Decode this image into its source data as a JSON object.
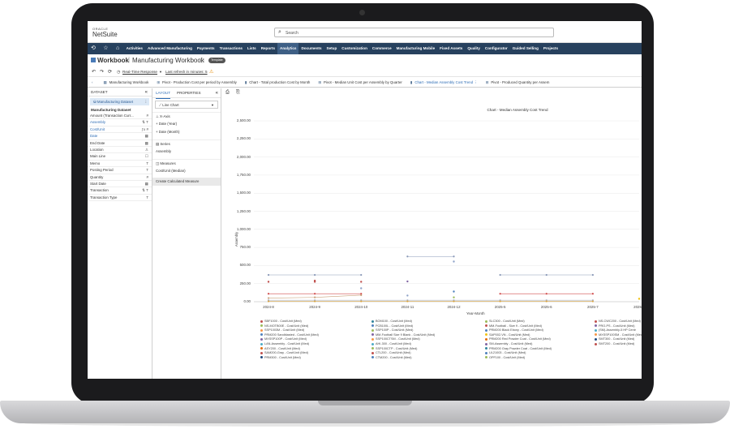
{
  "header": {
    "oracle": "ORACLE",
    "brand": "NetSuite",
    "search_placeholder": "Search"
  },
  "nav": {
    "icons": [
      "history-icon",
      "star-icon",
      "home-icon"
    ],
    "items": [
      "Activities",
      "Advanced Manufacturing",
      "Payments",
      "Transactions",
      "Lists",
      "Reports",
      "Analytics",
      "Documents",
      "Setup",
      "Customization",
      "Commerce",
      "Manufacturing Mobile",
      "Fixed Assets",
      "Quality",
      "Configurator",
      "Guided Selling",
      "Projects"
    ],
    "active_index": 6
  },
  "title": {
    "label": "Workbook",
    "name": "Manufacturing Workbook",
    "badge": "Template"
  },
  "response": {
    "mode": "Real-Time Response",
    "refresh": "Last refresh in minutes: 5"
  },
  "tabs": [
    {
      "icon": "chevron-left-icon",
      "label": ""
    },
    {
      "icon": "table-icon",
      "label": "Manufacturing Workbook"
    },
    {
      "icon": "pivot-icon",
      "label": "Pivot - Production Cost per period by Assembly"
    },
    {
      "icon": "chart-icon",
      "label": "Chart - Total production Cost by Month"
    },
    {
      "icon": "pivot-icon",
      "label": "Pivot - Median Unit Cost per Assembly by Quarter"
    },
    {
      "icon": "chart-icon",
      "label": "Chart - Median Assembly Cost Trend",
      "active": true
    },
    {
      "icon": "pivot-icon",
      "label": "Pivot - Produced Quantity per Assem"
    }
  ],
  "dataset": {
    "header": "DATASET",
    "button": "Manufacturing Dataset",
    "name": "Manufacturing Dataset",
    "fields": [
      {
        "label": "Amount (Transaction Curr...",
        "type": "#",
        "blue": false
      },
      {
        "label": "Assembly",
        "type": "⇅ T",
        "blue": true
      },
      {
        "label": "Cost/Unit",
        "type": "ƒx #",
        "blue": true
      },
      {
        "label": "Date",
        "type": "▦",
        "blue": true
      },
      {
        "label": "End Date",
        "type": "▦",
        "blue": false
      },
      {
        "label": "Location",
        "type": "♙",
        "blue": false
      },
      {
        "label": "Main Line",
        "type": "☐",
        "blue": false
      },
      {
        "label": "Memo",
        "type": "T",
        "blue": false
      },
      {
        "label": "Posting Period",
        "type": "T",
        "blue": false
      },
      {
        "label": "Quantity",
        "type": "#",
        "blue": false
      },
      {
        "label": "Start Date",
        "type": "▦",
        "blue": false
      },
      {
        "label": "Transaction",
        "type": "⇅ T",
        "blue": false
      },
      {
        "label": "Transaction Type",
        "type": "T",
        "blue": false
      }
    ]
  },
  "layout_panel": {
    "tab_layout": "LAYOUT",
    "tab_properties": "PROPERTIES",
    "chart_type": "Line Chart",
    "xaxis_title": "X-Axis",
    "xaxis_items": [
      "Date (Year)",
      "Date (Month)"
    ],
    "series_title": "Series",
    "series_items": [
      "Assembly"
    ],
    "measures_title": "Measures",
    "measures_items": [
      "Cost/Unit (Median)"
    ],
    "calc_button": "Create Calculated Measure"
  },
  "chart_data": {
    "type": "line",
    "title": "Chart - Median Assembly Cost Trend",
    "xlabel": "Year-Month",
    "ylabel": "Assembly",
    "categories": [
      "2024-8",
      "2024-9",
      "2024-10",
      "2024-11",
      "2024-12",
      "2025-5",
      "2025-6",
      "2025-7",
      "2025-8"
    ],
    "yticks": [
      "0.00",
      "250.00",
      "500.00",
      "750.00",
      "1,000.00",
      "1,250.00",
      "1,500.00",
      "1,750.00",
      "2,000.00",
      "2,250.00",
      "2,500.00"
    ],
    "ylim": [
      0,
      2500
    ],
    "grid": true,
    "legend_placement": "bottom",
    "series": [
      {
        "name": "SBF1000 - Cost/Unit (Med)",
        "color": "#c0504d",
        "values": [
          275,
          275,
          275,
          null,
          null,
          null,
          null,
          null,
          null
        ]
      },
      {
        "name": "NS-MOTB00E - Cost/Unit (Med)",
        "color": "#9bbb59",
        "values": [
          null,
          null,
          null,
          null,
          null,
          null,
          null,
          null,
          null
        ]
      },
      {
        "name": "SSP1003M - Cost/Unit (Med)",
        "color": "#f79646",
        "values": [
          null,
          null,
          null,
          null,
          null,
          null,
          null,
          null,
          null
        ]
      },
      {
        "name": "PRM200 Sandblasted - Cost/Unit (Med)",
        "color": "#4f81bd",
        "values": [
          null,
          null,
          null,
          null,
          null,
          null,
          null,
          null,
          null
        ]
      },
      {
        "name": "MXSSP100P - Cost/Unit (Med)",
        "color": "#8064a2",
        "values": [
          null,
          null,
          null,
          null,
          null,
          null,
          null,
          null,
          null
        ]
      },
      {
        "name": "LAN-Assembly - Cost/Unit (Med)",
        "color": "#4bacc6",
        "values": [
          null,
          null,
          null,
          null,
          null,
          null,
          null,
          null,
          null
        ]
      },
      {
        "name": "ASY200 - Cost/Unit (Med)",
        "color": "#e36c09",
        "values": [
          null,
          null,
          null,
          null,
          null,
          null,
          null,
          null,
          null
        ]
      },
      {
        "name": "SAM200-Gray - Cost/Unit (Med)",
        "color": "#c0504d",
        "values": [
          null,
          null,
          null,
          null,
          null,
          null,
          null,
          null,
          null
        ]
      },
      {
        "name": "PRM300 - Cost/Unit (Med)",
        "color": "#1f497d",
        "values": [
          null,
          null,
          null,
          null,
          null,
          null,
          null,
          null,
          null
        ]
      },
      {
        "name": "BOM100 - Cost/Unit (Med)",
        "color": "#31859c",
        "values": [
          null,
          null,
          null,
          null,
          null,
          null,
          null,
          null,
          null
        ]
      },
      {
        "name": "PCB100L - Cost/Unit (Med)",
        "color": "#4f81bd",
        "values": [
          null,
          null,
          null,
          null,
          null,
          null,
          null,
          null,
          null
        ]
      },
      {
        "name": "SSP100P - Cost/Unit (Med)",
        "color": "#9bbb59",
        "values": [
          null,
          null,
          null,
          null,
          null,
          null,
          null,
          null,
          null
        ]
      },
      {
        "name": "MM-Football Size 9 Blank - Cost/Unit (Med)",
        "color": "#8064a2",
        "values": [
          null,
          null,
          null,
          null,
          null,
          null,
          null,
          null,
          null
        ]
      },
      {
        "name": "SSP100CTSM - Cost/Unit (Med)",
        "color": "#f79646",
        "values": [
          null,
          null,
          null,
          null,
          null,
          null,
          null,
          null,
          null
        ]
      },
      {
        "name": "AHI-300 - Cost/Unit (Med)",
        "color": "#4bacc6",
        "values": [
          null,
          null,
          null,
          null,
          null,
          null,
          null,
          null,
          null
        ]
      },
      {
        "name": "SSP100CTP - Cost/Unit (Med)",
        "color": "#9bbb59",
        "values": [
          null,
          null,
          null,
          null,
          null,
          null,
          null,
          null,
          null
        ]
      },
      {
        "name": "CTL200 - Cost/Unit (Med)",
        "color": "#c0504d",
        "values": [
          null,
          null,
          null,
          null,
          null,
          null,
          null,
          null,
          null
        ]
      },
      {
        "name": "CTM200 - Cost/Unit (Med)",
        "color": "#4f81bd",
        "values": [
          null,
          null,
          null,
          null,
          null,
          null,
          null,
          null,
          null
        ]
      },
      {
        "name": "SLC300 - Cost/Unit (Med)",
        "color": "#9bbb59",
        "values": [
          null,
          null,
          null,
          null,
          null,
          null,
          null,
          null,
          null
        ]
      },
      {
        "name": "MM-Football - Size 9 - Cost/Unit (Med)",
        "color": "#c0504d",
        "values": [
          null,
          null,
          null,
          null,
          null,
          null,
          null,
          null,
          null
        ]
      },
      {
        "name": "PRM200 Black Ebony - Cost/Unit (Med)",
        "color": "#4f81bd",
        "values": [
          null,
          null,
          null,
          null,
          null,
          null,
          null,
          null,
          null
        ]
      },
      {
        "name": "SAP002-VN - Cost/Unit (Med)",
        "color": "#f2c314",
        "values": [
          null,
          null,
          null,
          null,
          null,
          null,
          null,
          null,
          40
        ]
      },
      {
        "name": "PRM200 Red Powder Coat - Cost/Unit (Med)",
        "color": "#e36c09",
        "values": [
          null,
          null,
          null,
          null,
          null,
          null,
          null,
          null,
          null
        ]
      },
      {
        "name": "SM-Assembly - Cost/Unit (Med)",
        "color": "#8064a2",
        "values": [
          null,
          null,
          null,
          null,
          null,
          null,
          null,
          null,
          null
        ]
      },
      {
        "name": "PRM200 Gray Powder Coat - Cost/Unit (Med)",
        "color": "#31859c",
        "values": [
          null,
          null,
          null,
          null,
          null,
          null,
          null,
          null,
          null
        ]
      },
      {
        "name": "UL21003 - Cost/Unit (Med)",
        "color": "#4f81bd",
        "values": [
          null,
          null,
          null,
          null,
          null,
          null,
          null,
          null,
          null
        ]
      },
      {
        "name": "OPF100 - Cost/Unit (Med)",
        "color": "#9bbb59",
        "values": [
          null,
          null,
          null,
          null,
          null,
          null,
          null,
          null,
          null
        ]
      },
      {
        "name": "NS-CWC200 - Cost/Unit (Med)",
        "color": "#c0504d",
        "values": [
          null,
          null,
          null,
          null,
          null,
          null,
          null,
          null,
          null
        ]
      },
      {
        "name": "PRO-PS - Cost/Unit (Med)",
        "color": "#8064a2",
        "values": [
          null,
          null,
          null,
          null,
          null,
          null,
          null,
          null,
          null
        ]
      },
      {
        "name": "(SM)-Assembly-5 HP Centr",
        "color": "#4bacc6",
        "values": [
          null,
          null,
          null,
          null,
          null,
          null,
          null,
          null,
          null
        ]
      },
      {
        "name": "MXSSP100SM - Cost/Unit (Med)",
        "color": "#f79646",
        "values": [
          null,
          null,
          null,
          null,
          null,
          null,
          null,
          null,
          null
        ]
      },
      {
        "name": "SMT300 - Cost/Unit (Med)",
        "color": "#1f497d",
        "values": [
          null,
          null,
          null,
          null,
          null,
          null,
          null,
          null,
          null
        ]
      },
      {
        "name": "SMT200 - Cost/Unit (Med)",
        "color": "#c0504d",
        "values": [
          null,
          null,
          null,
          null,
          null,
          null,
          null,
          null,
          null
        ]
      }
    ],
    "lines": [
      {
        "color": "#8a99b8",
        "values": [
          370,
          370,
          370,
          null,
          null,
          370,
          370,
          370,
          null
        ]
      },
      {
        "color": "#8a99b8",
        "values": [
          null,
          null,
          null,
          625,
          625,
          null,
          null,
          null,
          null
        ]
      },
      {
        "color": "#d04a4a",
        "values": [
          110,
          110,
          110,
          null,
          null,
          110,
          110,
          110,
          null
        ]
      },
      {
        "color": "#c9a07a",
        "values": [
          50,
          60,
          90,
          null,
          null,
          null,
          null,
          null,
          null
        ]
      },
      {
        "color": "#aeb7cc",
        "values": [
          20,
          20,
          20,
          20,
          20,
          20,
          20,
          20,
          null
        ]
      },
      {
        "color": "#d9a441",
        "values": [
          5,
          5,
          5,
          5,
          5,
          5,
          5,
          5,
          null
        ]
      }
    ],
    "points": [
      {
        "x": "2024-9",
        "y": 290,
        "color": "#c0504d"
      },
      {
        "x": "2024-10",
        "y": 185,
        "color": "#8fa3c9"
      },
      {
        "x": "2024-11",
        "y": 280,
        "color": "#8064a2"
      },
      {
        "x": "2024-11",
        "y": 85,
        "color": "#8fa3c9"
      },
      {
        "x": "2024-12",
        "y": 555,
        "color": "#8fa3c9"
      },
      {
        "x": "2024-12",
        "y": 140,
        "color": "#4f81bd"
      },
      {
        "x": "2024-12",
        "y": 60,
        "color": "#9bbb59"
      },
      {
        "x": "2025-8",
        "y": 40,
        "color": "#f2c314"
      }
    ]
  }
}
